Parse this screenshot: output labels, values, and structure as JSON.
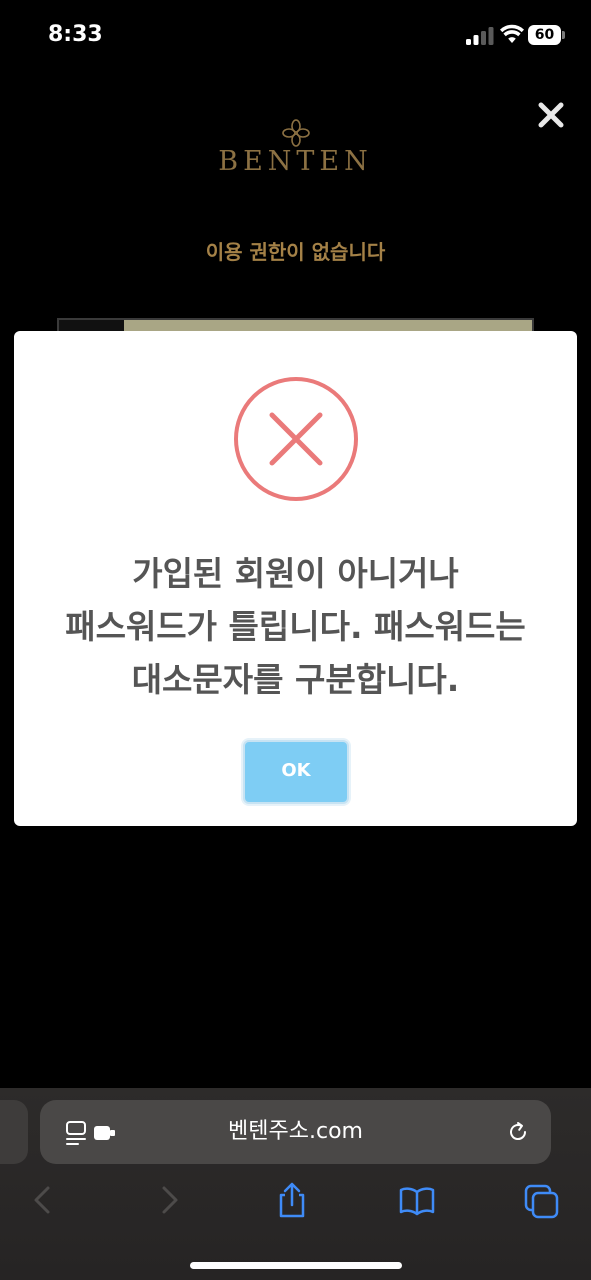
{
  "status_bar": {
    "time": "8:33",
    "battery": "60"
  },
  "page": {
    "logo": "BENTEN",
    "no_permission": "이용 권한이 없습니다"
  },
  "alert": {
    "message_lines": [
      "가입된 회원이 아니거나",
      "패스워드가 틀립니다. 패스워드는",
      "대소문자를 구분합니다."
    ],
    "ok_label": "OK",
    "icon_color": "#ea7a7a",
    "ok_color": "#7ecdf4"
  },
  "browser": {
    "url": "벤텐주소.com"
  }
}
